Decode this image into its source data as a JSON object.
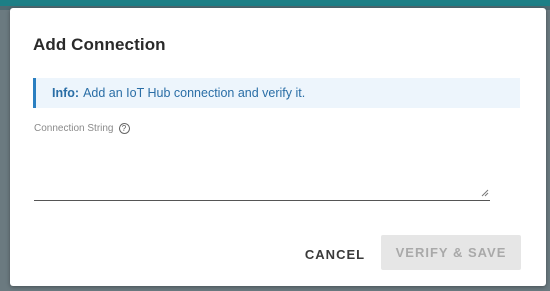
{
  "dialog": {
    "title": "Add Connection",
    "info": {
      "label": "Info:",
      "text": "Add an IoT Hub connection and verify it.",
      "accent_color": "#2a7fc1"
    },
    "connection_string": {
      "label": "Connection String",
      "help_icon": "question-circle-icon",
      "value": ""
    },
    "actions": {
      "cancel_label": "CANCEL",
      "verify_save_label": "VERIFY & SAVE",
      "verify_save_enabled": false
    }
  }
}
